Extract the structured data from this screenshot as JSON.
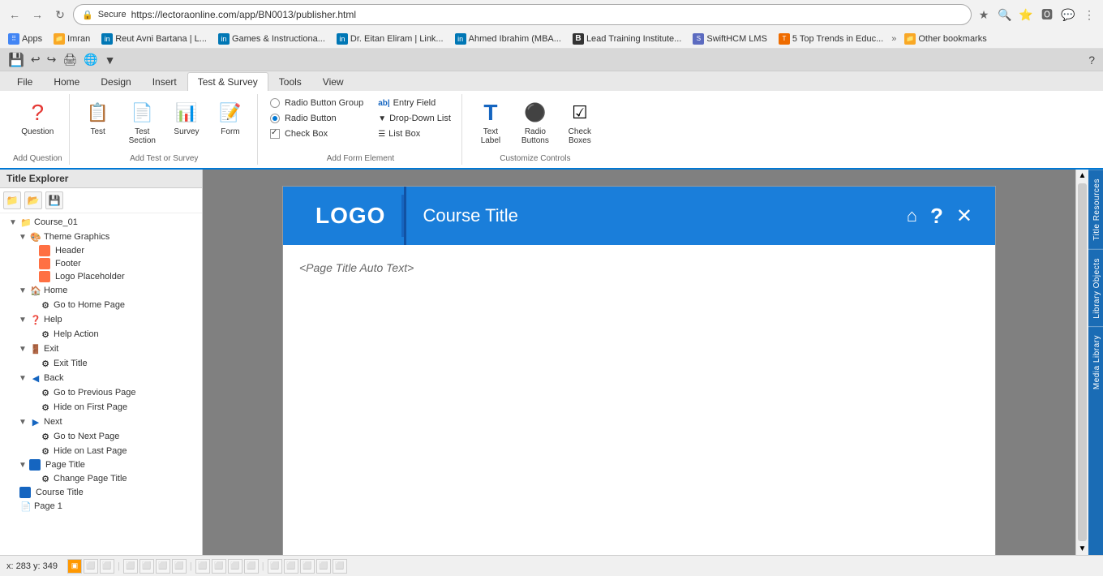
{
  "browser": {
    "url": "https://lectoraonline.com/app/BN0013/publisher.html",
    "back_btn": "←",
    "forward_btn": "→",
    "reload_btn": "↺",
    "home_btn": "⌂",
    "lock": "🔒",
    "secure_label": "Secure",
    "bookmarks": [
      {
        "label": "Apps",
        "type": "apps"
      },
      {
        "label": "Imran",
        "type": "folder"
      },
      {
        "label": "Reut Avni Bartana | L...",
        "type": "linkedin"
      },
      {
        "label": "Games & Instructiona...",
        "type": "linkedin"
      },
      {
        "label": "Dr. Eitan Eliram | Link...",
        "type": "linkedin"
      },
      {
        "label": "Ahmed Ibrahim (MBA...",
        "type": "linkedin"
      },
      {
        "label": "Lead Training Institute...",
        "type": "b"
      },
      {
        "label": "SwiftHCM LMS",
        "type": "folder"
      },
      {
        "label": "5 Top Trends in Educ...",
        "type": "other"
      },
      {
        "label": "Other bookmarks",
        "type": "folder"
      }
    ]
  },
  "quick_access": {
    "icons": [
      "💾",
      "↩",
      "↪",
      "🖨",
      "🌐",
      "▼"
    ]
  },
  "ribbon": {
    "tabs": [
      "File",
      "Home",
      "Design",
      "Insert",
      "Test & Survey",
      "Tools",
      "View"
    ],
    "active_tab": "Test & Survey",
    "groups": [
      {
        "label": "Add Question",
        "items_large": [
          {
            "id": "question-btn",
            "icon": "❓",
            "label": "Question",
            "color": "#e53935"
          }
        ]
      },
      {
        "label": "Add Test or Survey",
        "items_large": [
          {
            "id": "test-btn",
            "icon": "📋",
            "label": "Test",
            "color": "#e53935"
          },
          {
            "id": "test-section-btn",
            "icon": "📄",
            "label": "Test\nSection",
            "color": "#e53935"
          },
          {
            "id": "survey-btn",
            "icon": "📊",
            "label": "Survey",
            "color": "#1565c0"
          },
          {
            "id": "form-btn",
            "icon": "📝",
            "label": "Form",
            "color": "#1565c0"
          }
        ]
      },
      {
        "label": "Add Form Element",
        "items_small": [
          {
            "id": "radio-group-btn",
            "label": "Radio Button Group"
          },
          {
            "id": "radio-btn-item",
            "label": "Radio Button"
          },
          {
            "id": "check-box-btn",
            "label": "Check Box"
          },
          {
            "id": "entry-field-btn",
            "label": "Entry Field"
          },
          {
            "id": "dropdown-btn",
            "label": "Drop-Down List"
          },
          {
            "id": "list-box-btn",
            "label": "List Box"
          }
        ]
      },
      {
        "label": "",
        "items_large": [
          {
            "id": "text-label-btn",
            "icon": "T",
            "label": "Text\nLabel",
            "color": "#1565c0"
          },
          {
            "id": "radio-buttons-btn",
            "icon": "⚫",
            "label": "Radio\nButtons",
            "color": "#333"
          },
          {
            "id": "check-boxes-btn",
            "icon": "☑",
            "label": "Check\nBoxes",
            "color": "#333"
          }
        ],
        "sublabel": "Customize Controls"
      }
    ]
  },
  "title_explorer": {
    "header": "Title Explorer",
    "toolbar_icons": [
      "📁",
      "📂",
      "💾"
    ],
    "tree": [
      {
        "id": "course-01",
        "label": "Course_01",
        "level": 0,
        "toggle": "▼",
        "icon": "📁",
        "type": "folder"
      },
      {
        "id": "theme-graphics",
        "label": "Theme Graphics",
        "level": 1,
        "toggle": "▼",
        "icon": "🎨",
        "type": "theme"
      },
      {
        "id": "header",
        "label": "Header",
        "level": 2,
        "toggle": "",
        "icon": "🟧",
        "type": "item"
      },
      {
        "id": "footer",
        "label": "Footer",
        "level": 2,
        "toggle": "",
        "icon": "🟧",
        "type": "item"
      },
      {
        "id": "logo-placeholder",
        "label": "Logo Placeholder",
        "level": 2,
        "toggle": "",
        "icon": "🟧",
        "type": "item"
      },
      {
        "id": "home",
        "label": "Home",
        "level": 1,
        "toggle": "▼",
        "icon": "🏠",
        "type": "folder"
      },
      {
        "id": "go-to-home-page",
        "label": "Go to Home Page",
        "level": 2,
        "toggle": "",
        "icon": "⚙",
        "type": "action"
      },
      {
        "id": "help",
        "label": "Help",
        "level": 1,
        "toggle": "▼",
        "icon": "❓",
        "type": "folder"
      },
      {
        "id": "help-action",
        "label": "Help Action",
        "level": 2,
        "toggle": "",
        "icon": "⚙",
        "type": "action"
      },
      {
        "id": "exit",
        "label": "Exit",
        "level": 1,
        "toggle": "▼",
        "icon": "🚪",
        "type": "folder"
      },
      {
        "id": "exit-title",
        "label": "Exit Title",
        "level": 2,
        "toggle": "",
        "icon": "⚙",
        "type": "action"
      },
      {
        "id": "back",
        "label": "Back",
        "level": 1,
        "toggle": "▼",
        "icon": "◀",
        "type": "folder"
      },
      {
        "id": "go-to-prev-page",
        "label": "Go to Previous Page",
        "level": 2,
        "toggle": "",
        "icon": "⚙",
        "type": "action"
      },
      {
        "id": "hide-on-first-page",
        "label": "Hide on First Page",
        "level": 2,
        "toggle": "",
        "icon": "⚙",
        "type": "action"
      },
      {
        "id": "next",
        "label": "Next",
        "level": 1,
        "toggle": "▼",
        "icon": "▶",
        "type": "folder"
      },
      {
        "id": "go-to-next-page",
        "label": "Go to Next Page",
        "level": 2,
        "toggle": "",
        "icon": "⚙",
        "type": "action"
      },
      {
        "id": "hide-on-last-page",
        "label": "Hide on Last Page",
        "level": 2,
        "toggle": "",
        "icon": "⚙",
        "type": "action"
      },
      {
        "id": "page-title",
        "label": "Page Title",
        "level": 1,
        "toggle": "▼",
        "icon": "📄",
        "type": "page-title"
      },
      {
        "id": "change-page-title",
        "label": "Change Page Title",
        "level": 2,
        "toggle": "",
        "icon": "⚙",
        "type": "action"
      },
      {
        "id": "course-title",
        "label": "Course Title",
        "level": 0,
        "toggle": "",
        "icon": "📄",
        "type": "course"
      },
      {
        "id": "page-1",
        "label": "Page 1",
        "level": 0,
        "toggle": "",
        "icon": "📄",
        "type": "page"
      }
    ]
  },
  "canvas": {
    "logo": "LOGO",
    "course_title": "Course Title",
    "page_title_placeholder": "<Page Title Auto Text>",
    "header_icons": [
      "⌂",
      "?",
      "✕"
    ]
  },
  "right_tabs": [
    {
      "id": "title-resources",
      "label": "Title Resources"
    },
    {
      "id": "library-objects",
      "label": "Library Objects"
    },
    {
      "id": "media-library",
      "label": "Media Library"
    }
  ],
  "status_bar": {
    "coords": "x: 283  y: 349",
    "icons": [
      "📐",
      "📏",
      "📊",
      "⬜",
      "⬜",
      "⬜",
      "⬜",
      "⬜",
      "⬜",
      "⬜",
      "⬜",
      "⬜",
      "⬜",
      "⬜"
    ]
  }
}
